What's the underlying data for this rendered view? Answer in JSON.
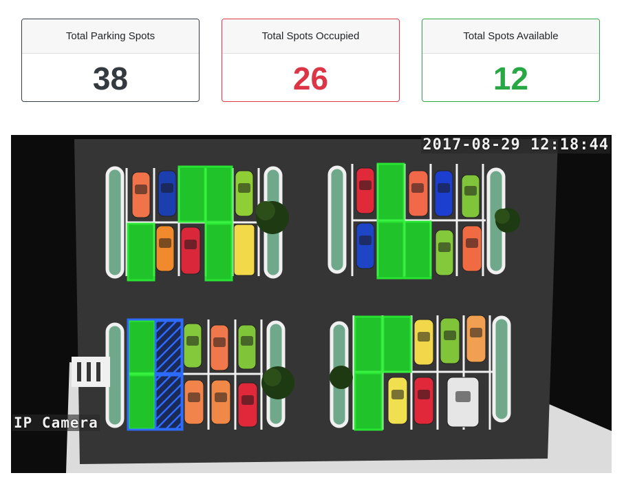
{
  "stats": {
    "total": {
      "label": "Total Parking Spots",
      "value": "38",
      "color": "#343a40"
    },
    "occupied": {
      "label": "Total Spots Occupied",
      "value": "26",
      "color": "#dc3545"
    },
    "available": {
      "label": "Total Spots Available",
      "value": "12",
      "color": "#28a745"
    }
  },
  "camera": {
    "timestamp": "2017-08-29 12:18:44",
    "label": "IP Camera",
    "colors": {
      "free_spot": "#22d02a",
      "reserved_spot": "#1d4fd6",
      "asphalt": "#3a3a3a",
      "line": "#f2f2f2"
    }
  }
}
